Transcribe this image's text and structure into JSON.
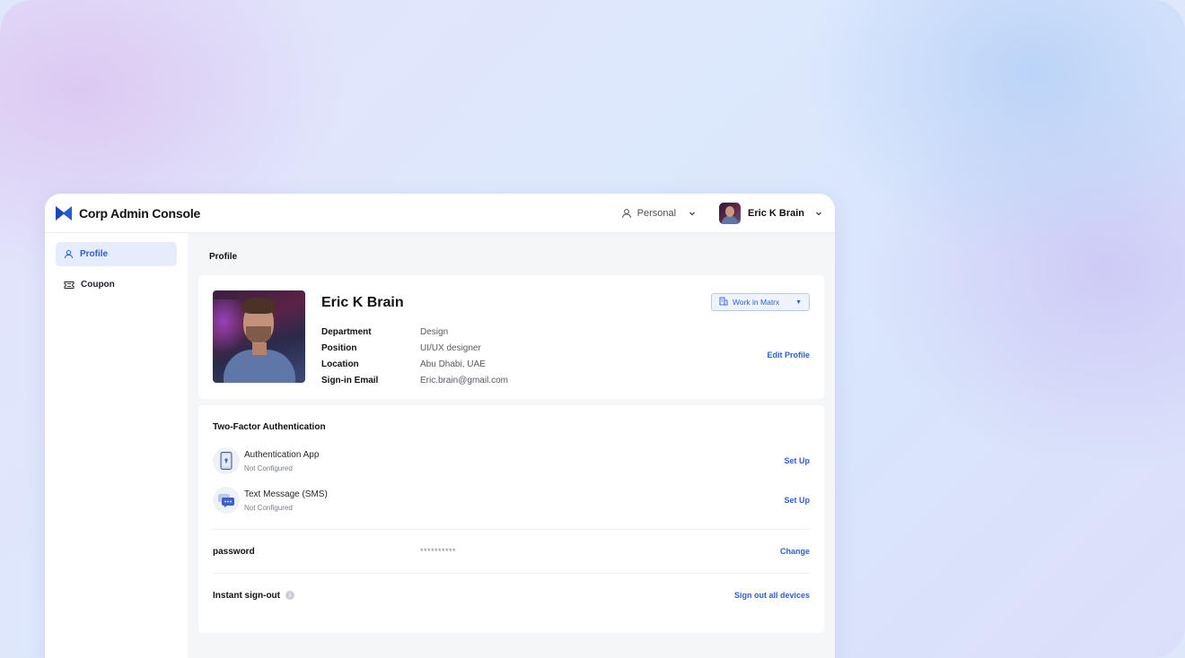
{
  "app": {
    "title": "Corp Admin Console"
  },
  "topbar": {
    "workspace": "Personal",
    "user_name": "Eric K Brain"
  },
  "sidebar": {
    "items": [
      {
        "label": "Profile",
        "icon": "user-icon",
        "active": true
      },
      {
        "label": "Coupon",
        "icon": "ticket-icon",
        "active": false
      }
    ]
  },
  "page": {
    "title": "Profile"
  },
  "profile": {
    "name": "Eric K Brain",
    "organization": "Work in Matrx",
    "edit_label": "Edit Profile",
    "fields": [
      {
        "label": "Department",
        "value": "Design"
      },
      {
        "label": "Position",
        "value": "UI/UX designer"
      },
      {
        "label": "Location",
        "value": "Abu Dhabi, UAE"
      },
      {
        "label": "Sign-in Email",
        "value": "Eric.brain@gmail.com"
      }
    ]
  },
  "security": {
    "title": "Two-Factor Authentication",
    "methods": [
      {
        "name": "Authentication App",
        "status": "Not Configured",
        "action": "Set Up",
        "icon": "phone-lock-icon"
      },
      {
        "name": "Text Message (SMS)",
        "status": "Not Configured",
        "action": "Set Up",
        "icon": "sms-icon"
      }
    ],
    "password": {
      "label": "password",
      "masked": "**********",
      "action": "Change"
    },
    "signout": {
      "label": "Instant sign-out",
      "action": "Sign out all devices"
    }
  },
  "colors": {
    "accent": "#2e5ed6",
    "active_bg": "#e6ecfb"
  }
}
